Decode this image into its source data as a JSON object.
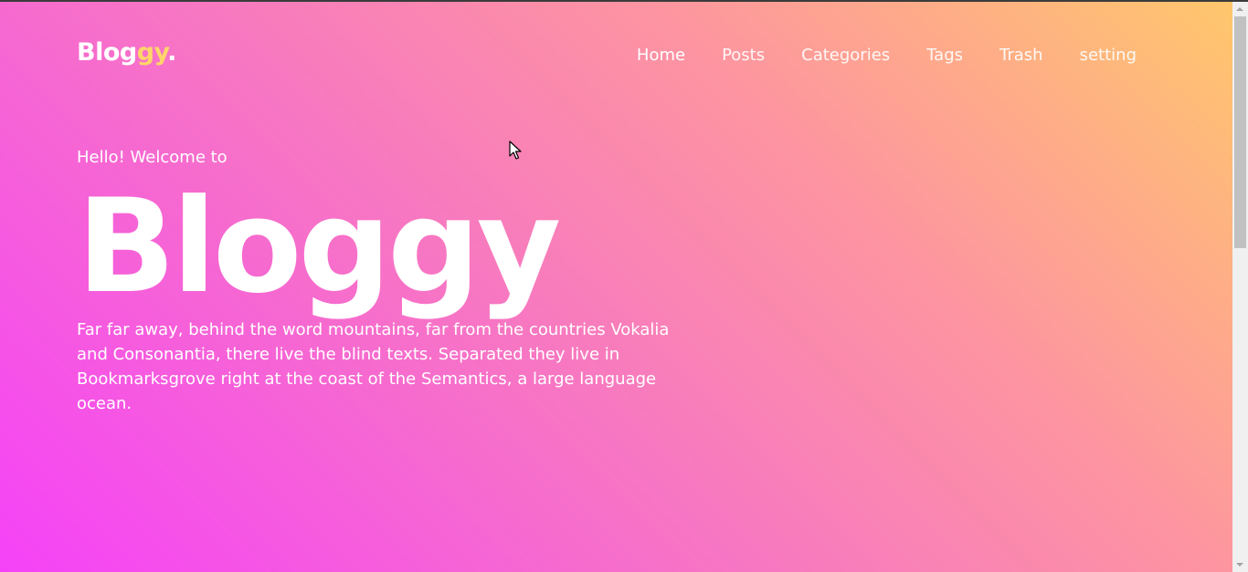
{
  "logo": {
    "main": "Blog",
    "accent": "gy",
    "dot": "."
  },
  "nav": {
    "items": [
      {
        "label": "Home",
        "name": "nav-home"
      },
      {
        "label": "Posts",
        "name": "nav-posts"
      },
      {
        "label": "Categories",
        "name": "nav-categories"
      },
      {
        "label": "Tags",
        "name": "nav-tags"
      },
      {
        "label": "Trash",
        "name": "nav-trash"
      },
      {
        "label": "setting",
        "name": "nav-setting"
      }
    ]
  },
  "hero": {
    "greeting": "Hello! Welcome to",
    "title": "Bloggy",
    "description": "Far far away, behind the word mountains, far from the countries Vokalia and Consonantia, there live the blind texts. Separated they live in Bookmarksgrove right at the coast of the Semantics, a large language ocean."
  },
  "colors": {
    "gradient_top_right": "#ffc76c",
    "gradient_bottom_left": "#f542f8",
    "logo_accent": "#ffd56a",
    "text": "#ffffff"
  },
  "icons": {
    "cursor": "mouse-pointer-icon"
  }
}
